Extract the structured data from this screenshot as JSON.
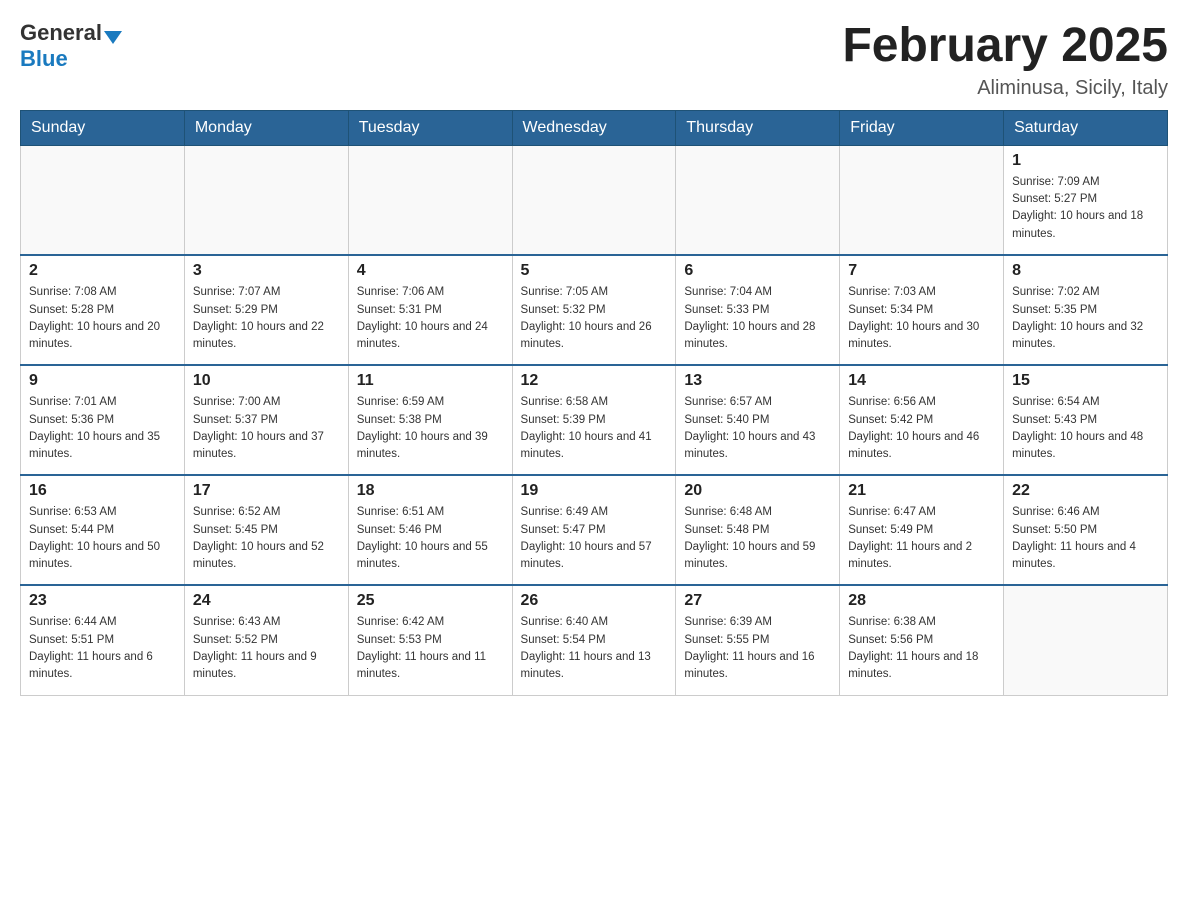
{
  "header": {
    "logo": {
      "general": "General",
      "blue": "Blue",
      "arrow": "▼"
    },
    "title": "February 2025",
    "subtitle": "Aliminusa, Sicily, Italy"
  },
  "days_of_week": [
    "Sunday",
    "Monday",
    "Tuesday",
    "Wednesday",
    "Thursday",
    "Friday",
    "Saturday"
  ],
  "weeks": [
    {
      "days": [
        {
          "number": "",
          "sunrise": "",
          "sunset": "",
          "daylight": "",
          "empty": true
        },
        {
          "number": "",
          "sunrise": "",
          "sunset": "",
          "daylight": "",
          "empty": true
        },
        {
          "number": "",
          "sunrise": "",
          "sunset": "",
          "daylight": "",
          "empty": true
        },
        {
          "number": "",
          "sunrise": "",
          "sunset": "",
          "daylight": "",
          "empty": true
        },
        {
          "number": "",
          "sunrise": "",
          "sunset": "",
          "daylight": "",
          "empty": true
        },
        {
          "number": "",
          "sunrise": "",
          "sunset": "",
          "daylight": "",
          "empty": true
        },
        {
          "number": "1",
          "sunrise": "Sunrise: 7:09 AM",
          "sunset": "Sunset: 5:27 PM",
          "daylight": "Daylight: 10 hours and 18 minutes.",
          "empty": false
        }
      ]
    },
    {
      "days": [
        {
          "number": "2",
          "sunrise": "Sunrise: 7:08 AM",
          "sunset": "Sunset: 5:28 PM",
          "daylight": "Daylight: 10 hours and 20 minutes.",
          "empty": false
        },
        {
          "number": "3",
          "sunrise": "Sunrise: 7:07 AM",
          "sunset": "Sunset: 5:29 PM",
          "daylight": "Daylight: 10 hours and 22 minutes.",
          "empty": false
        },
        {
          "number": "4",
          "sunrise": "Sunrise: 7:06 AM",
          "sunset": "Sunset: 5:31 PM",
          "daylight": "Daylight: 10 hours and 24 minutes.",
          "empty": false
        },
        {
          "number": "5",
          "sunrise": "Sunrise: 7:05 AM",
          "sunset": "Sunset: 5:32 PM",
          "daylight": "Daylight: 10 hours and 26 minutes.",
          "empty": false
        },
        {
          "number": "6",
          "sunrise": "Sunrise: 7:04 AM",
          "sunset": "Sunset: 5:33 PM",
          "daylight": "Daylight: 10 hours and 28 minutes.",
          "empty": false
        },
        {
          "number": "7",
          "sunrise": "Sunrise: 7:03 AM",
          "sunset": "Sunset: 5:34 PM",
          "daylight": "Daylight: 10 hours and 30 minutes.",
          "empty": false
        },
        {
          "number": "8",
          "sunrise": "Sunrise: 7:02 AM",
          "sunset": "Sunset: 5:35 PM",
          "daylight": "Daylight: 10 hours and 32 minutes.",
          "empty": false
        }
      ]
    },
    {
      "days": [
        {
          "number": "9",
          "sunrise": "Sunrise: 7:01 AM",
          "sunset": "Sunset: 5:36 PM",
          "daylight": "Daylight: 10 hours and 35 minutes.",
          "empty": false
        },
        {
          "number": "10",
          "sunrise": "Sunrise: 7:00 AM",
          "sunset": "Sunset: 5:37 PM",
          "daylight": "Daylight: 10 hours and 37 minutes.",
          "empty": false
        },
        {
          "number": "11",
          "sunrise": "Sunrise: 6:59 AM",
          "sunset": "Sunset: 5:38 PM",
          "daylight": "Daylight: 10 hours and 39 minutes.",
          "empty": false
        },
        {
          "number": "12",
          "sunrise": "Sunrise: 6:58 AM",
          "sunset": "Sunset: 5:39 PM",
          "daylight": "Daylight: 10 hours and 41 minutes.",
          "empty": false
        },
        {
          "number": "13",
          "sunrise": "Sunrise: 6:57 AM",
          "sunset": "Sunset: 5:40 PM",
          "daylight": "Daylight: 10 hours and 43 minutes.",
          "empty": false
        },
        {
          "number": "14",
          "sunrise": "Sunrise: 6:56 AM",
          "sunset": "Sunset: 5:42 PM",
          "daylight": "Daylight: 10 hours and 46 minutes.",
          "empty": false
        },
        {
          "number": "15",
          "sunrise": "Sunrise: 6:54 AM",
          "sunset": "Sunset: 5:43 PM",
          "daylight": "Daylight: 10 hours and 48 minutes.",
          "empty": false
        }
      ]
    },
    {
      "days": [
        {
          "number": "16",
          "sunrise": "Sunrise: 6:53 AM",
          "sunset": "Sunset: 5:44 PM",
          "daylight": "Daylight: 10 hours and 50 minutes.",
          "empty": false
        },
        {
          "number": "17",
          "sunrise": "Sunrise: 6:52 AM",
          "sunset": "Sunset: 5:45 PM",
          "daylight": "Daylight: 10 hours and 52 minutes.",
          "empty": false
        },
        {
          "number": "18",
          "sunrise": "Sunrise: 6:51 AM",
          "sunset": "Sunset: 5:46 PM",
          "daylight": "Daylight: 10 hours and 55 minutes.",
          "empty": false
        },
        {
          "number": "19",
          "sunrise": "Sunrise: 6:49 AM",
          "sunset": "Sunset: 5:47 PM",
          "daylight": "Daylight: 10 hours and 57 minutes.",
          "empty": false
        },
        {
          "number": "20",
          "sunrise": "Sunrise: 6:48 AM",
          "sunset": "Sunset: 5:48 PM",
          "daylight": "Daylight: 10 hours and 59 minutes.",
          "empty": false
        },
        {
          "number": "21",
          "sunrise": "Sunrise: 6:47 AM",
          "sunset": "Sunset: 5:49 PM",
          "daylight": "Daylight: 11 hours and 2 minutes.",
          "empty": false
        },
        {
          "number": "22",
          "sunrise": "Sunrise: 6:46 AM",
          "sunset": "Sunset: 5:50 PM",
          "daylight": "Daylight: 11 hours and 4 minutes.",
          "empty": false
        }
      ]
    },
    {
      "days": [
        {
          "number": "23",
          "sunrise": "Sunrise: 6:44 AM",
          "sunset": "Sunset: 5:51 PM",
          "daylight": "Daylight: 11 hours and 6 minutes.",
          "empty": false
        },
        {
          "number": "24",
          "sunrise": "Sunrise: 6:43 AM",
          "sunset": "Sunset: 5:52 PM",
          "daylight": "Daylight: 11 hours and 9 minutes.",
          "empty": false
        },
        {
          "number": "25",
          "sunrise": "Sunrise: 6:42 AM",
          "sunset": "Sunset: 5:53 PM",
          "daylight": "Daylight: 11 hours and 11 minutes.",
          "empty": false
        },
        {
          "number": "26",
          "sunrise": "Sunrise: 6:40 AM",
          "sunset": "Sunset: 5:54 PM",
          "daylight": "Daylight: 11 hours and 13 minutes.",
          "empty": false
        },
        {
          "number": "27",
          "sunrise": "Sunrise: 6:39 AM",
          "sunset": "Sunset: 5:55 PM",
          "daylight": "Daylight: 11 hours and 16 minutes.",
          "empty": false
        },
        {
          "number": "28",
          "sunrise": "Sunrise: 6:38 AM",
          "sunset": "Sunset: 5:56 PM",
          "daylight": "Daylight: 11 hours and 18 minutes.",
          "empty": false
        },
        {
          "number": "",
          "sunrise": "",
          "sunset": "",
          "daylight": "",
          "empty": true
        }
      ]
    }
  ]
}
